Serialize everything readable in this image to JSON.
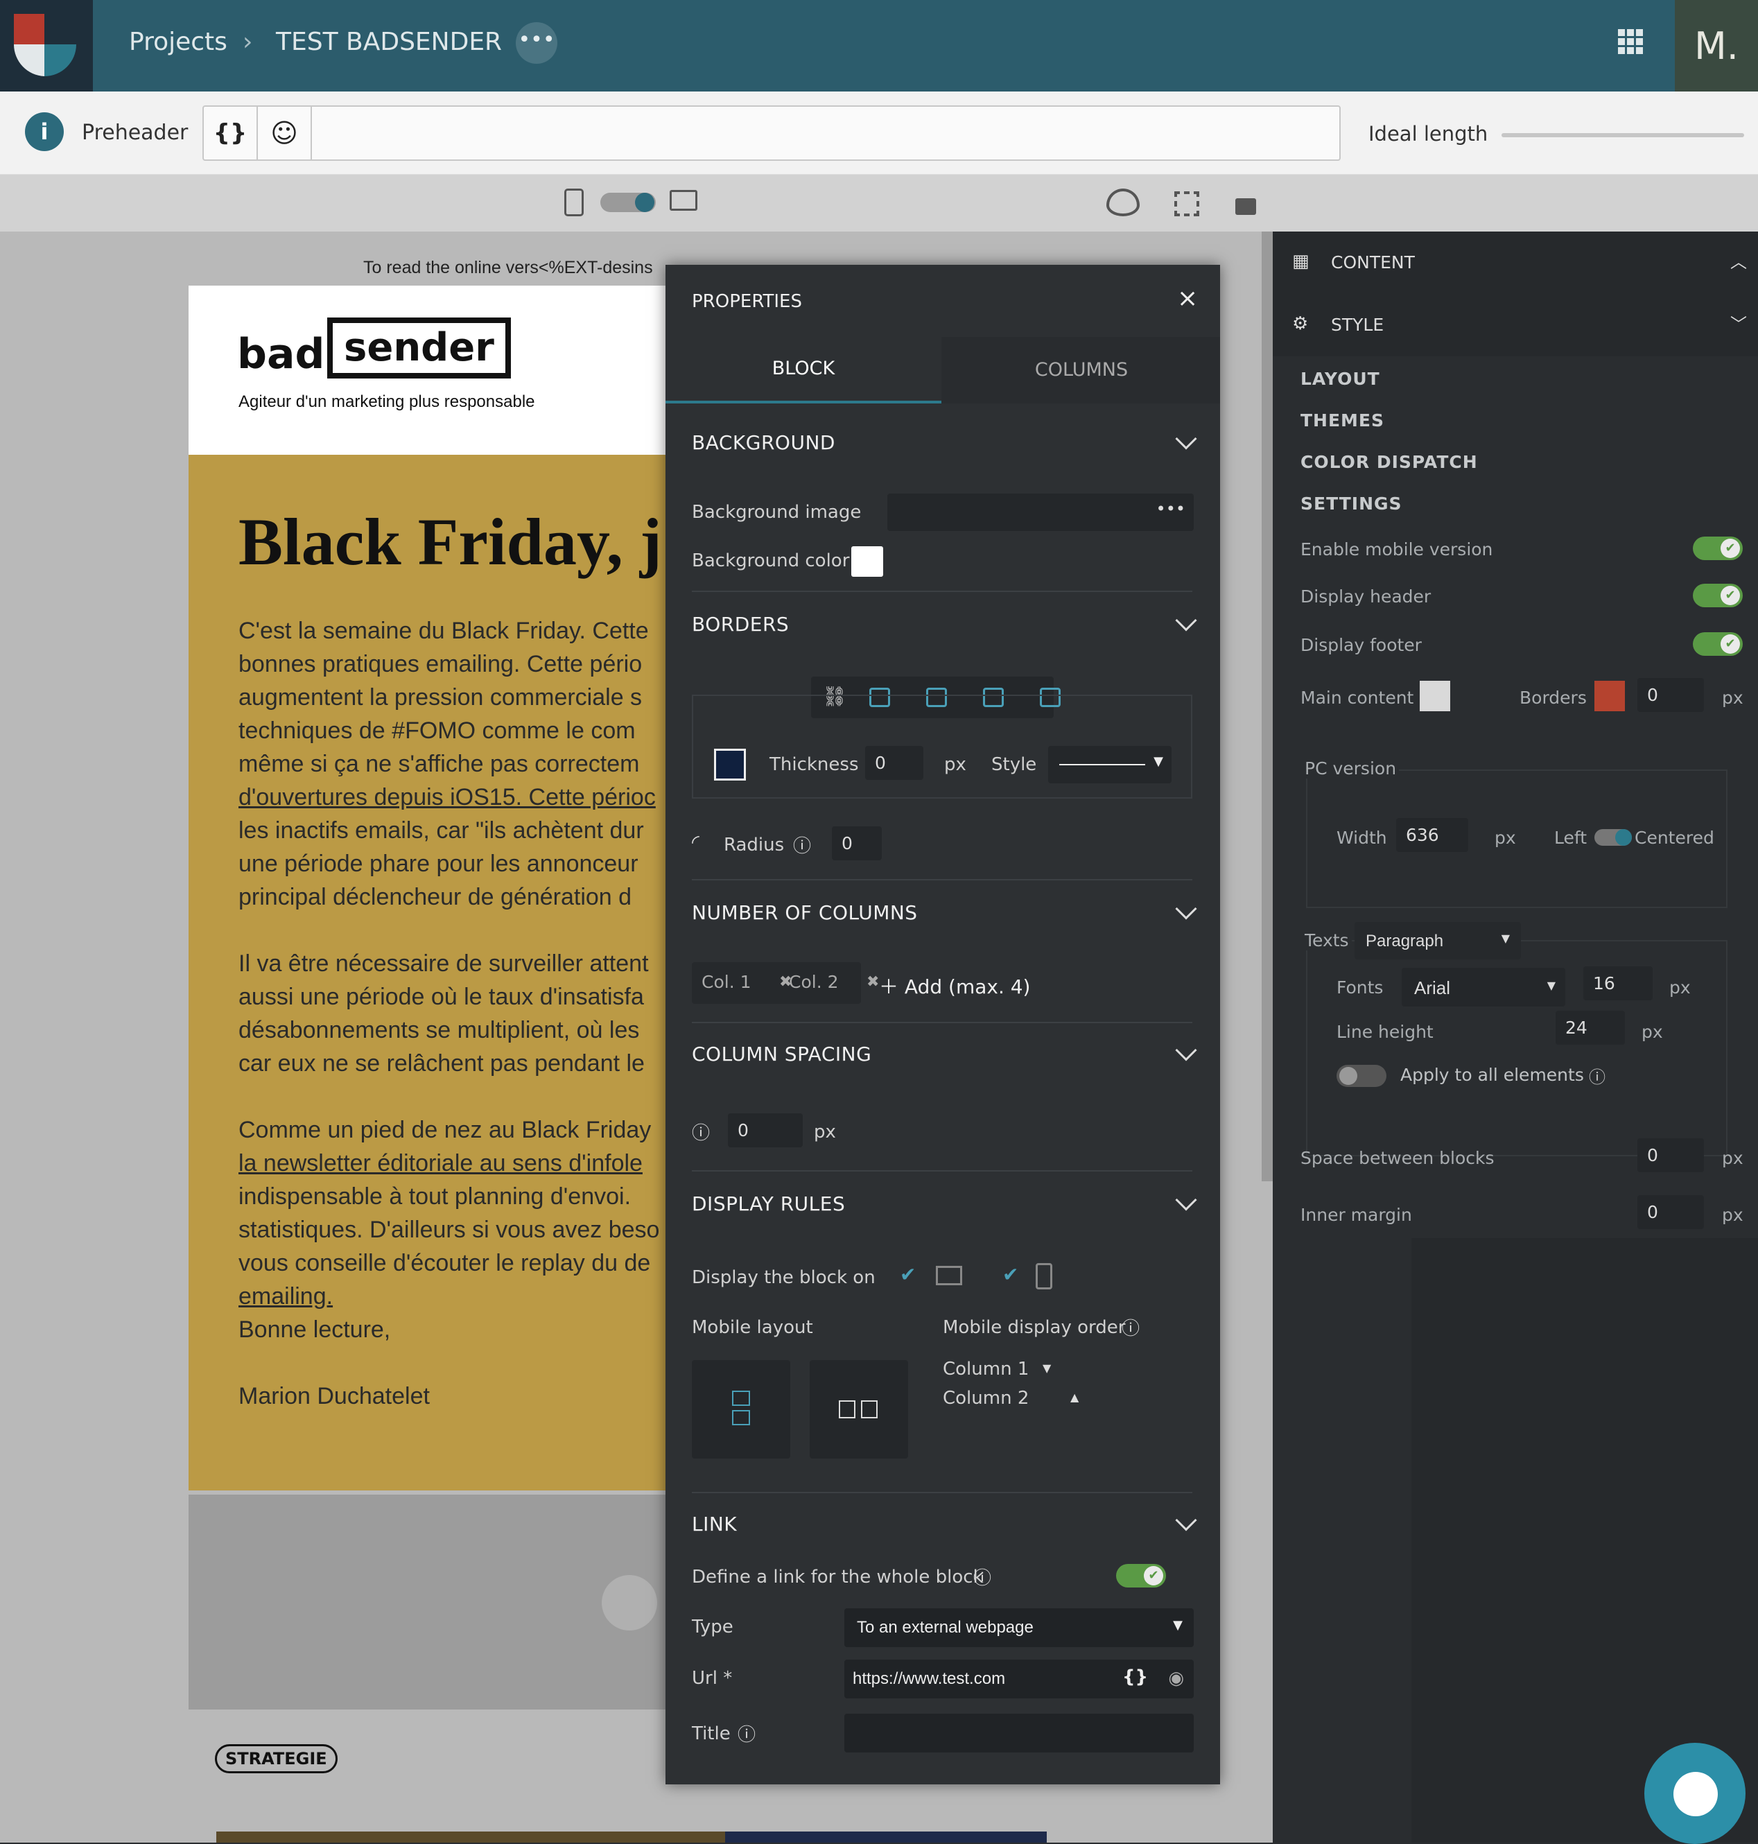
{
  "topbar": {
    "projects": "Projects",
    "separator": "›",
    "project_name": "TEST BADSENDER",
    "avatar": "M."
  },
  "preheader": {
    "label": "Preheader",
    "vars_btn": "{}",
    "ideal_length": "Ideal length",
    "value": ""
  },
  "email": {
    "online_text": "To read the online vers<%EXT-desins",
    "brand_bad": "bad",
    "brand_sender": "sender",
    "tagline": "Agiteur d'un marketing plus responsable",
    "headline": "Black Friday, j",
    "p1": [
      "C'est la semaine du Black Friday. Cette",
      "bonnes pratiques emailing. Cette pério",
      "augmentent la pression commerciale s",
      "techniques de #FOMO comme le com",
      "même si ça ne s'affiche pas correctem",
      "d'ouvertures depuis iOS15. Cette périoc",
      "les inactifs emails, car \"ils achètent dur",
      "une période phare pour les annonceur",
      "principal déclencheur de génération d"
    ],
    "p2": [
      "Il va être nécessaire de surveiller attent",
      "aussi une période où le taux d'insatisfa",
      "désabonnements se multiplient, où les",
      "car eux ne se relâchent pas pendant le"
    ],
    "p3": [
      "Comme un pied de nez au Black Friday",
      "la newsletter éditoriale au sens d'infole",
      "indispensable à tout planning d'envoi.",
      "statistiques. D'ailleurs si vous avez beso",
      "vous conseille d'écouter le replay du de",
      "emailing."
    ],
    "greeting": "Bonne lecture,",
    "signature": "Marion Duchatelet",
    "tag": "STRATEGIE"
  },
  "panel": {
    "title": "PROPERTIES",
    "tabs": [
      "BLOCK",
      "COLUMNS"
    ],
    "background": {
      "title": "BACKGROUND",
      "image_label": "Background image",
      "color_label": "Background color",
      "image_value": ""
    },
    "borders": {
      "title": "BORDERS",
      "thickness_label": "Thickness",
      "thickness": "0",
      "unit": "px",
      "style_label": "Style",
      "radius_label": "Radius",
      "radius": "0",
      "color": "#10203e"
    },
    "columns": {
      "title": "NUMBER OF COLUMNS",
      "items": [
        "Col. 1",
        "Col. 2"
      ],
      "add": "Add (max. 4)"
    },
    "spacing": {
      "title": "COLUMN SPACING",
      "value": "0",
      "unit": "px"
    },
    "display": {
      "title": "DISPLAY RULES",
      "display_on": "Display the block on",
      "mobile_layout": "Mobile layout",
      "mobile_order": "Mobile display order",
      "order": [
        "Column 1",
        "Column 2"
      ]
    },
    "link": {
      "title": "LINK",
      "define_label": "Define a link for the whole block",
      "type_label": "Type",
      "type_value": "To an external webpage",
      "url_label": "Url *",
      "url_value": "https://www.test.com",
      "title_label": "Title",
      "title_value": ""
    }
  },
  "right": {
    "content": "CONTENT",
    "style": "STYLE",
    "layout": "LAYOUT",
    "themes": "THEMES",
    "color_dispatch": "COLOR DISPATCH",
    "settings": "SETTINGS",
    "enable_mobile": "Enable mobile version",
    "display_header": "Display header",
    "display_footer": "Display footer",
    "main_content": "Main content",
    "borders": "Borders",
    "borders_value": "0",
    "px": "px",
    "pc_version": "PC version",
    "width_label": "Width",
    "width_value": "636",
    "left": "Left",
    "centered": "Centered",
    "texts_label": "Texts",
    "texts_value": "Paragraph",
    "fonts_label": "Fonts",
    "fonts_value": "Arial",
    "font_size": "16",
    "line_height_label": "Line height",
    "line_height": "24",
    "apply_all": "Apply to all elements",
    "space_between": "Space between blocks",
    "space_value": "0",
    "inner_margin": "Inner margin",
    "inner_value": "0",
    "colors": {
      "main_content": "#d9d9d9",
      "borders": "#b5432f"
    }
  }
}
